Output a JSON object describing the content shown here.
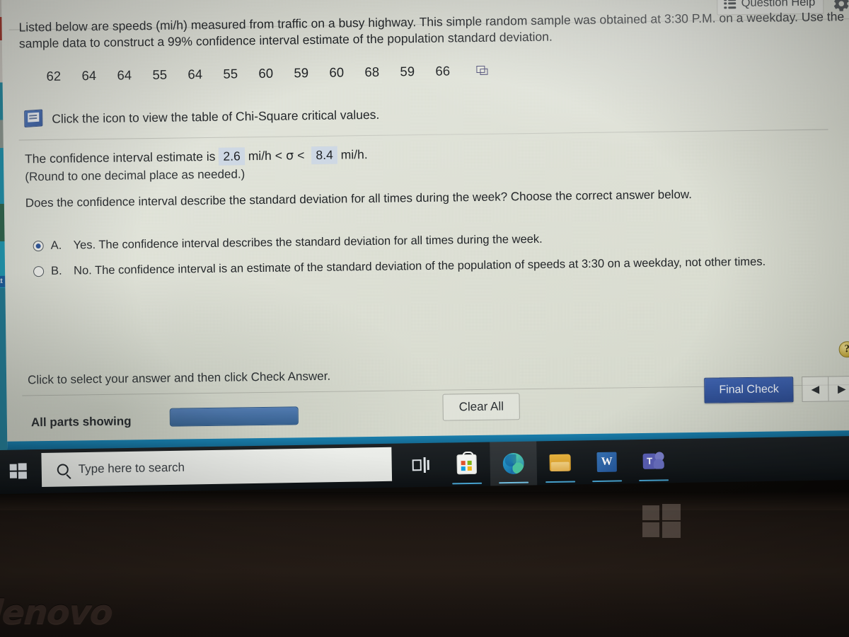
{
  "header": {
    "question_help_label": "Question Help",
    "list_icon": "list-icon",
    "gear_icon": "gear-icon"
  },
  "problem": {
    "prompt": "Listed below are speeds (mi/h) measured from traffic on a busy highway. This simple random sample was obtained at 3:30 P.M. on a weekday. Use the sample data to construct a 99% confidence interval estimate of the population standard deviation.",
    "data_values": [
      "62",
      "64",
      "64",
      "55",
      "64",
      "55",
      "60",
      "59",
      "60",
      "68",
      "59",
      "66"
    ],
    "popout_icon": "popout-to-spreadsheet-icon",
    "resource_icon": "book-icon",
    "resource_text": "Click the icon to view the table of Chi-Square critical values."
  },
  "answer": {
    "ci_prefix": "The confidence interval estimate is",
    "lower_value": "2.6",
    "unit_lower": "mi/h",
    "inequality_left": "<",
    "sigma": "σ",
    "inequality_right": "<",
    "upper_value": "8.4",
    "unit_upper": "mi/h.",
    "rounding_note": "(Round to one decimal place as needed.)",
    "sub_question": "Does the confidence interval describe the standard deviation for all times during the week? Choose the correct answer below.",
    "choices": [
      {
        "letter": "A.",
        "text": "Yes. The confidence interval describes the standard deviation for all times during the week.",
        "selected": true
      },
      {
        "letter": "B.",
        "text": "No. The confidence interval is an estimate of the standard deviation of the population of speeds at 3:30 on a weekday, not other times.",
        "selected": false
      }
    ],
    "help_badge": "?"
  },
  "footer": {
    "hint_text": "Click to select your answer and then click Check Answer.",
    "all_parts_label": "All parts showing",
    "check_answer_label": "",
    "clear_all_label": "Clear All",
    "final_check_label": "Final Check",
    "prev_icon": "◀",
    "next_icon": "▶"
  },
  "taskbar": {
    "start_icon": "windows-start-icon",
    "search_placeholder": "Type here to search",
    "search_icon": "search-icon",
    "items": [
      {
        "name": "task-view-icon",
        "label": "Task View"
      },
      {
        "name": "microsoft-store-icon",
        "label": "Microsoft Store"
      },
      {
        "name": "microsoft-edge-icon",
        "label": "Microsoft Edge"
      },
      {
        "name": "file-explorer-icon",
        "label": "File Explorer"
      },
      {
        "name": "microsoft-word-icon",
        "label": "W"
      },
      {
        "name": "microsoft-teams-icon",
        "label": "T"
      }
    ]
  },
  "device": {
    "brand_logo": "lenovo",
    "windows_emblem": "windows-logo-emblem"
  },
  "colors": {
    "accent_blue": "#33669f",
    "final_check_blue": "#2a4d9c",
    "fill_box": "#cdd8e6",
    "screen_bg": "#e2e5d9",
    "taskbar": "#141a1e"
  }
}
